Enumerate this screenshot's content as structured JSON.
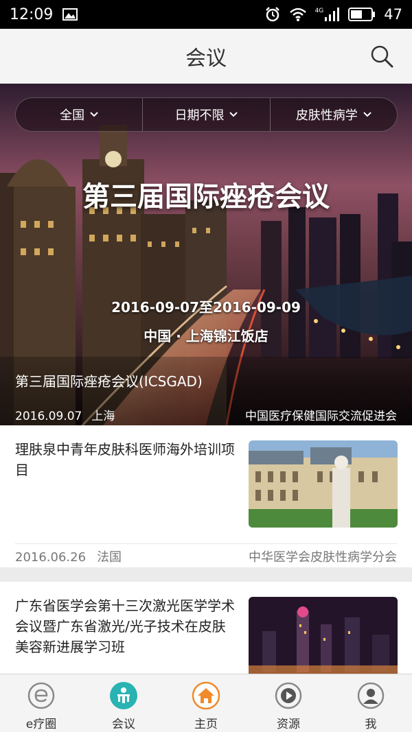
{
  "status_bar": {
    "time": "12:09",
    "battery": "47",
    "network": "4G"
  },
  "header": {
    "title": "会议"
  },
  "filters": [
    {
      "label": "全国"
    },
    {
      "label": "日期不限"
    },
    {
      "label": "皮肤性病学"
    }
  ],
  "hero": {
    "banner_title": "第三届国际痤疮会议",
    "banner_dates": "2016-09-07至2016-09-09",
    "banner_venue": "中国 · 上海锦江饭店",
    "caption": "第三届国际痤疮会议(ICSGAD)",
    "date": "2016.09.07",
    "location": "上海",
    "organizer": "中国医疗保健国际交流促进会"
  },
  "items": [
    {
      "title": "理肤泉中青年皮肤科医师海外培训项目",
      "date": "2016.06.26",
      "location": "法国",
      "organizer": "中华医学会皮肤性病学分会"
    },
    {
      "title": "广东省医学会第十三次激光医学学术会议暨广东省激光/光子技术在皮肤美容新进展学习班"
    }
  ],
  "tabs": [
    {
      "label": "e疗圈",
      "icon": "e-circle-icon"
    },
    {
      "label": "会议",
      "icon": "meeting-icon",
      "active": true
    },
    {
      "label": "主页",
      "icon": "home-icon"
    },
    {
      "label": "资源",
      "icon": "play-icon"
    },
    {
      "label": "我",
      "icon": "profile-icon"
    }
  ],
  "colors": {
    "accent": "#2ab3b3",
    "home_orange": "#f08a2a"
  }
}
